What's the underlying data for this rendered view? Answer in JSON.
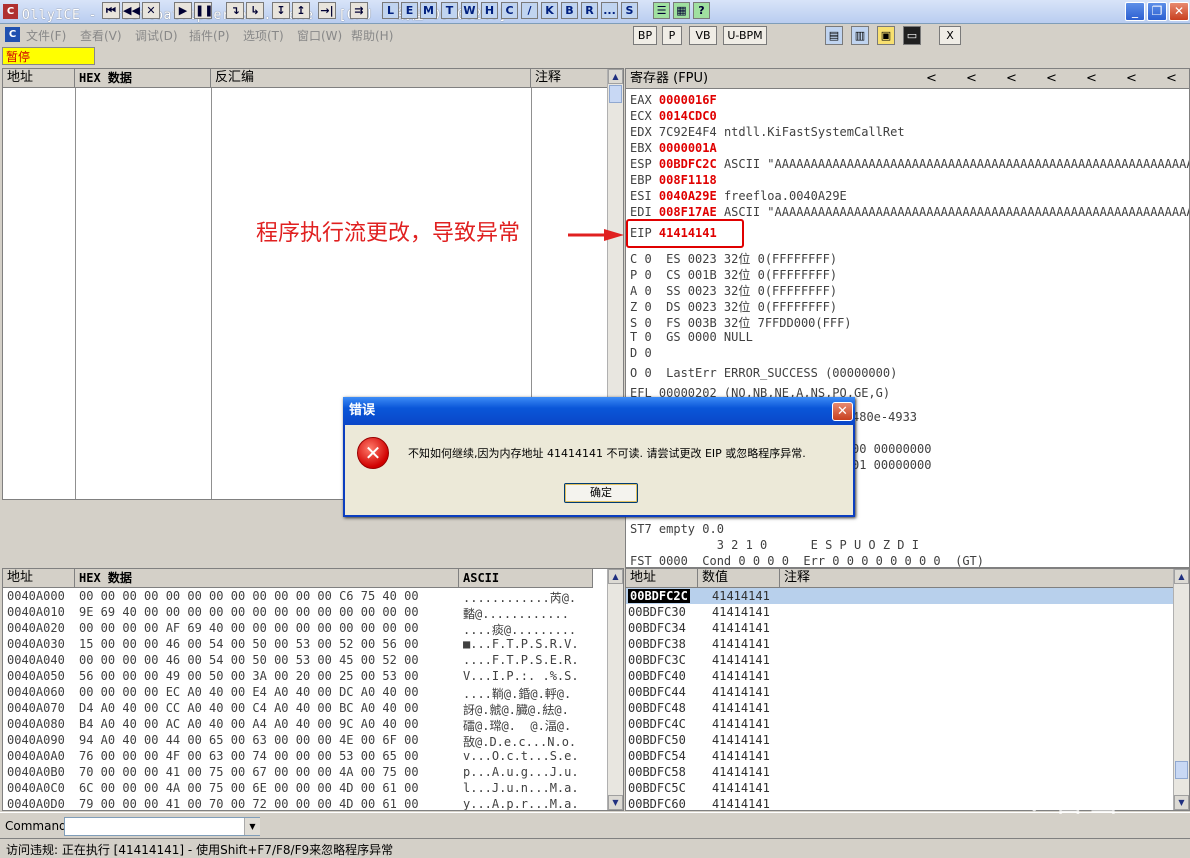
{
  "window": {
    "title": "OllyICE - freefloatftpserver1.0.exe - [CPU -  线程  00000240]",
    "app_icon": "C",
    "minimize": "_",
    "restore": "❐",
    "close": "✕"
  },
  "menu": [
    "文件(F)",
    "查看(V)",
    "调试(D)",
    "插件(P)",
    "选项(T)",
    "窗口(W)",
    "帮助(H)"
  ],
  "toolbar": {
    "status": "暂停",
    "nav_buttons": [
      "⏮",
      "◀◀",
      "✕",
      "▶",
      "❚❚",
      "↴",
      "↳",
      "↧",
      "↥",
      "→|",
      "⇉"
    ],
    "letter_buttons": [
      "L",
      "E",
      "M",
      "T",
      "W",
      "H",
      "C",
      "/",
      "K",
      "B",
      "R",
      "...",
      "S"
    ],
    "extra_buttons": [
      "☰",
      "▦",
      "?"
    ]
  },
  "right_toolbar": [
    "BP",
    "P",
    "VB",
    "U-BPM",
    "▤",
    "▥",
    "▣",
    "▭",
    "X"
  ],
  "disasm": {
    "headers": [
      "地址",
      "HEX 数据",
      "反汇编",
      "注释"
    ]
  },
  "registers": {
    "header": "寄存器 (FPU)",
    "chevrons": [
      "<",
      "<",
      "<",
      "<",
      "<",
      "<",
      "<"
    ],
    "lines": [
      {
        "name": "EAX",
        "value": "0000016F",
        "comment": "",
        "hl": true
      },
      {
        "name": "ECX",
        "value": "0014CDC0",
        "comment": "",
        "hl": true
      },
      {
        "name": "EDX",
        "value": "7C92E4F4",
        "comment": " ntdll.KiFastSystemCallRet",
        "hl": false
      },
      {
        "name": "EBX",
        "value": "0000001A",
        "comment": "",
        "hl": true
      },
      {
        "name": "ESP",
        "value": "00BDFC2C",
        "comment": " ASCII \"AAAAAAAAAAAAAAAAAAAAAAAAAAAAAAAAAAAAAAAAAAAAAAAAAAAAAAAAAA",
        "hl": true
      },
      {
        "name": "EBP",
        "value": "008F1118",
        "comment": "",
        "hl": true
      },
      {
        "name": "ESI",
        "value": "0040A29E",
        "comment": " freefloa.0040A29E",
        "hl": true
      },
      {
        "name": "EDI",
        "value": "008F17AE",
        "comment": " ASCII \"AAAAAAAAAAAAAAAAAAAAAAAAAAAAAAAAAAAAAAAAAAAAAAAAAAAAAAAAAA",
        "hl": true
      }
    ],
    "eip": {
      "name": "EIP",
      "value": "41414141"
    },
    "flags": [
      "C 0  ES 0023 32位 0(FFFFFFFF)",
      "P 0  CS 001B 32位 0(FFFFFFFF)",
      "A 0  SS 0023 32位 0(FFFFFFFF)",
      "Z 0  DS 0023 32位 0(FFFFFFFF)",
      "S 0  FS 003B 32位 7FFDD000(FFF)",
      "T 0  GS 0000 NULL",
      "D 0",
      "O 0  LastErr ERROR_SUCCESS (00000000)"
    ],
    "efl": "EFL 00000202 (NO,NB,NE,A,NS,PO,GE,G)",
    "fpu_partial": [
      "480e-4933",
      "00 00000000",
      "01 00000000"
    ],
    "st7": "ST7 empty 0.0",
    "fpu_bits": "            3 2 1 0      E S P U O Z D I",
    "fst": "FST 0000  Cond 0 0 0 0  Err 0 0 0 0 0 0 0 0  (GT)"
  },
  "annotation": "程序执行流更改，导致异常",
  "dialog": {
    "title": "错误",
    "icon": "✕",
    "close": "✕",
    "message": "不知如何继续,因为内存地址 41414141 不可读. 请尝试更改 EIP 或忽略程序异常.",
    "ok_label": "确定"
  },
  "dump": {
    "headers": [
      "地址",
      "HEX 数据",
      "ASCII"
    ],
    "rows": [
      {
        "addr": "0040A000",
        "hex": "00 00 00 00 00 00 00 00 00 00 00 00 C6 75 40 00",
        "ascii": "............芮@."
      },
      {
        "addr": "0040A010",
        "hex": "9E 69 40 00 00 00 00 00 00 00 00 00 00 00 00 00",
        "ascii": "濌@............"
      },
      {
        "addr": "0040A020",
        "hex": "00 00 00 00 AF 69 40 00 00 00 00 00 00 00 00 00",
        "ascii": "....痰@........."
      },
      {
        "addr": "0040A030",
        "hex": "15 00 00 00 46 00 54 00 50 00 53 00 52 00 56 00",
        "ascii": "■...F.T.P.S.R.V."
      },
      {
        "addr": "0040A040",
        "hex": "00 00 00 00 46 00 54 00 50 00 53 00 45 00 52 00",
        "ascii": "....F.T.P.S.E.R."
      },
      {
        "addr": "0040A050",
        "hex": "56 00 00 00 49 00 50 00 3A 00 20 00 25 00 53 00",
        "ascii": "V...I.P.:. .%.S."
      },
      {
        "addr": "0040A060",
        "hex": "00 00 00 00 EC A0 40 00 E4 A0 40 00 DC A0 40 00",
        "ascii": "....鞝@.錉@.軤@."
      },
      {
        "addr": "0040A070",
        "hex": "D4 A0 40 00 CC A0 40 00 C4 A0 40 00 BC A0 40 00",
        "ascii": "訝@.虩@.臓@.紶@."
      },
      {
        "addr": "0040A080",
        "hex": "B4 A0 40 00 AC A0 40 00 A4 A0 40 00 9C A0 40 00",
        "ascii": "礌@.瑺@.  @.湢@."
      },
      {
        "addr": "0040A090",
        "hex": "94 A0 40 00 44 00 65 00 63 00 00 00 4E 00 6F 00",
        "ascii": "敔@.D.e.c...N.o."
      },
      {
        "addr": "0040A0A0",
        "hex": "76 00 00 00 4F 00 63 00 74 00 00 00 53 00 65 00",
        "ascii": "v...O.c.t...S.e."
      },
      {
        "addr": "0040A0B0",
        "hex": "70 00 00 00 41 00 75 00 67 00 00 00 4A 00 75 00",
        "ascii": "p...A.u.g...J.u."
      },
      {
        "addr": "0040A0C0",
        "hex": "6C 00 00 00 4A 00 75 00 6E 00 00 00 4D 00 61 00",
        "ascii": "l...J.u.n...M.a."
      },
      {
        "addr": "0040A0D0",
        "hex": "79 00 00 00 41 00 70 00 72 00 00 00 4D 00 61 00",
        "ascii": "y...A.p.r...M.a."
      }
    ]
  },
  "stack": {
    "headers": [
      "地址",
      "数值",
      "注释"
    ],
    "rows": [
      {
        "addr": "00BDFC2C",
        "value": "41414141"
      },
      {
        "addr": "00BDFC30",
        "value": "41414141"
      },
      {
        "addr": "00BDFC34",
        "value": "41414141"
      },
      {
        "addr": "00BDFC38",
        "value": "41414141"
      },
      {
        "addr": "00BDFC3C",
        "value": "41414141"
      },
      {
        "addr": "00BDFC40",
        "value": "41414141"
      },
      {
        "addr": "00BDFC44",
        "value": "41414141"
      },
      {
        "addr": "00BDFC48",
        "value": "41414141"
      },
      {
        "addr": "00BDFC4C",
        "value": "41414141"
      },
      {
        "addr": "00BDFC50",
        "value": "41414141"
      },
      {
        "addr": "00BDFC54",
        "value": "41414141"
      },
      {
        "addr": "00BDFC58",
        "value": "41414141"
      },
      {
        "addr": "00BDFC5C",
        "value": "41414141"
      },
      {
        "addr": "00BDFC60",
        "value": "41414141"
      }
    ]
  },
  "command": {
    "label": "Command",
    "value": ""
  },
  "status": "访问违规: 正在执行 [41414141] - 使用Shift+F7/F8/F9来忽略程序异常",
  "watermark": "❋看雪",
  "colors": {
    "register_changed": "#e00000",
    "annotation": "#e02020",
    "dialog_title": "#0a56d8",
    "paused_bg": "#ffff00"
  }
}
